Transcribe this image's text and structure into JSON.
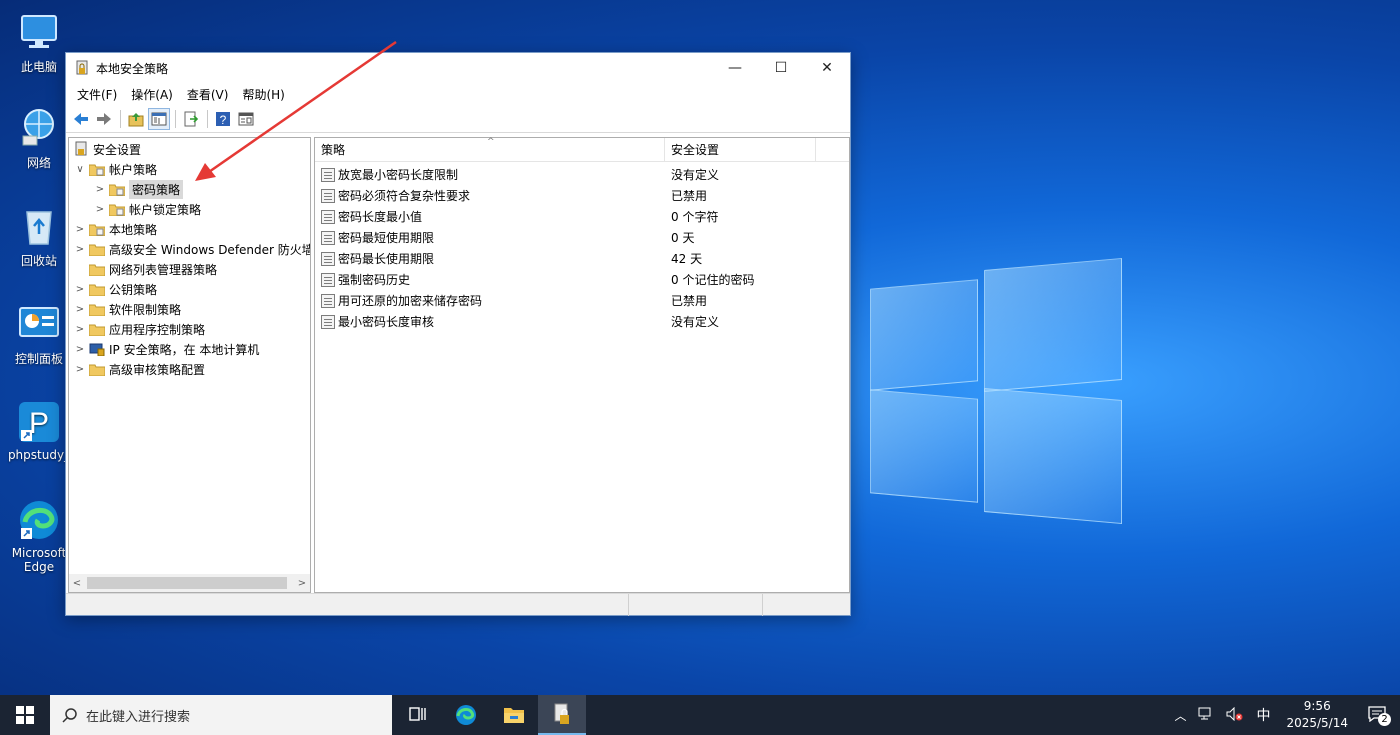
{
  "desktop": {
    "icons": [
      {
        "label": "此电脑",
        "icon": "computer-icon"
      },
      {
        "label": "网络",
        "icon": "network-icon"
      },
      {
        "label": "回收站",
        "icon": "recycle-bin-icon"
      },
      {
        "label": "控制面板",
        "icon": "control-panel-icon"
      },
      {
        "label": "phpstudy_",
        "icon": "phpstudy-icon"
      },
      {
        "label": "Microsoft Edge",
        "icon": "edge-icon"
      }
    ]
  },
  "window": {
    "title": "本地安全策略",
    "controls": {
      "minimize": "—",
      "maximize": "☐",
      "close": "✕"
    },
    "menu": [
      "文件(F)",
      "操作(A)",
      "查看(V)",
      "帮助(H)"
    ],
    "toolbar": [
      "back-icon",
      "forward-icon",
      "up-folder-icon",
      "show-hide-tree-icon",
      "export-list-icon",
      "help-icon",
      "properties-icon"
    ],
    "tree": [
      {
        "label": "安全设置",
        "level": 0,
        "expander": "",
        "icon": "security-settings-icon"
      },
      {
        "label": "帐户策略",
        "level": 1,
        "expander": "∨",
        "icon": "folder-lock-icon"
      },
      {
        "label": "密码策略",
        "level": 2,
        "expander": ">",
        "icon": "folder-lock-icon",
        "selected": true
      },
      {
        "label": "帐户锁定策略",
        "level": 2,
        "expander": ">",
        "icon": "folder-lock-icon"
      },
      {
        "label": "本地策略",
        "level": 1,
        "expander": ">",
        "icon": "folder-lock-icon"
      },
      {
        "label": "高级安全 Windows Defender 防火墙",
        "level": 1,
        "expander": ">",
        "icon": "folder-icon"
      },
      {
        "label": "网络列表管理器策略",
        "level": 1,
        "expander": "",
        "icon": "folder-icon"
      },
      {
        "label": "公钥策略",
        "level": 1,
        "expander": ">",
        "icon": "folder-icon"
      },
      {
        "label": "软件限制策略",
        "level": 1,
        "expander": ">",
        "icon": "folder-icon"
      },
      {
        "label": "应用程序控制策略",
        "level": 1,
        "expander": ">",
        "icon": "folder-icon"
      },
      {
        "label": "IP 安全策略，在 本地计算机",
        "level": 1,
        "expander": ">",
        "icon": "ip-security-icon"
      },
      {
        "label": "高级审核策略配置",
        "level": 1,
        "expander": ">",
        "icon": "folder-icon"
      }
    ],
    "columns": [
      "策略",
      "安全设置"
    ],
    "rows": [
      {
        "policy": "放宽最小密码长度限制",
        "setting": "没有定义"
      },
      {
        "policy": "密码必须符合复杂性要求",
        "setting": "已禁用"
      },
      {
        "policy": "密码长度最小值",
        "setting": "0 个字符"
      },
      {
        "policy": "密码最短使用期限",
        "setting": "0 天"
      },
      {
        "policy": "密码最长使用期限",
        "setting": "42 天"
      },
      {
        "policy": "强制密码历史",
        "setting": "0 个记住的密码"
      },
      {
        "policy": "用可还原的加密来储存密码",
        "setting": "已禁用"
      },
      {
        "policy": "最小密码长度审核",
        "setting": "没有定义"
      }
    ]
  },
  "taskbar": {
    "search_placeholder": "在此键入进行搜索",
    "ime": "中",
    "time": "9:56",
    "date": "2025/5/14",
    "notification_count": "2"
  },
  "colors": {
    "annotation_arrow": "#e53935",
    "taskbar": "#1b2433",
    "selection": "#d9d9d9"
  }
}
